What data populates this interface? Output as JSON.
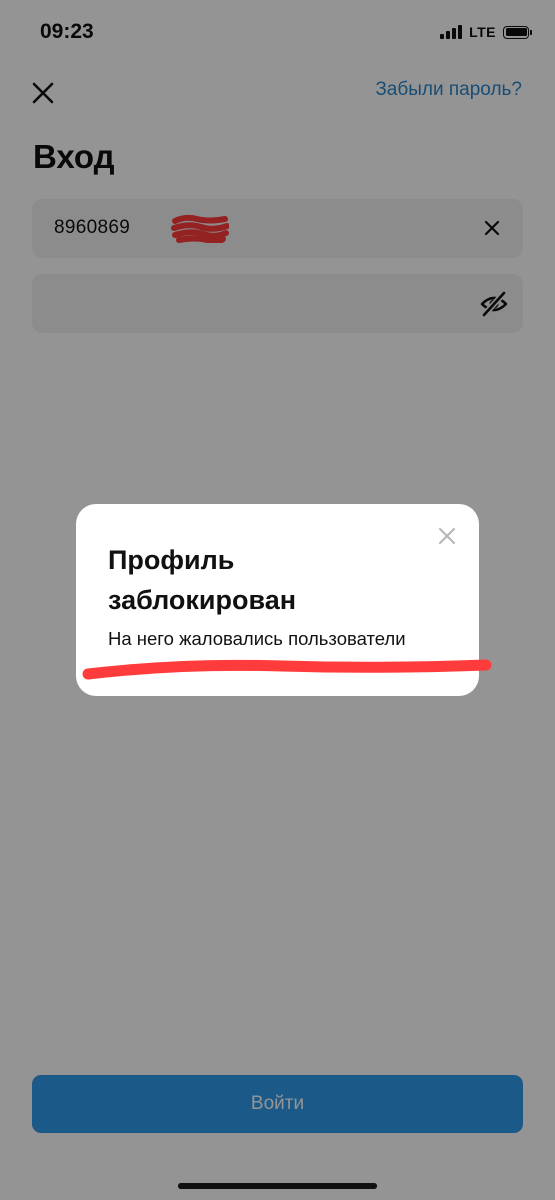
{
  "status_bar": {
    "time": "09:23",
    "network": "LTE"
  },
  "header": {
    "close_icon": "close-icon",
    "forgot_password_label": "Забыли пароль?",
    "title": "Вход"
  },
  "form": {
    "phone_value": "8960869",
    "password_value": "",
    "clear_icon": "clear-icon",
    "visibility_icon": "eye-off-icon"
  },
  "login_button": {
    "label": "Войти"
  },
  "dialog": {
    "title": "Профиль заблокирован",
    "message": "На него жаловались пользователи",
    "close_icon": "close-icon"
  },
  "colors": {
    "accent": "#2d86c8",
    "button": "#2f9aea",
    "field_bg": "#f2f2f2",
    "overlay": "rgba(0,0,0,0.42)",
    "markup_red": "#ff3b3b"
  }
}
